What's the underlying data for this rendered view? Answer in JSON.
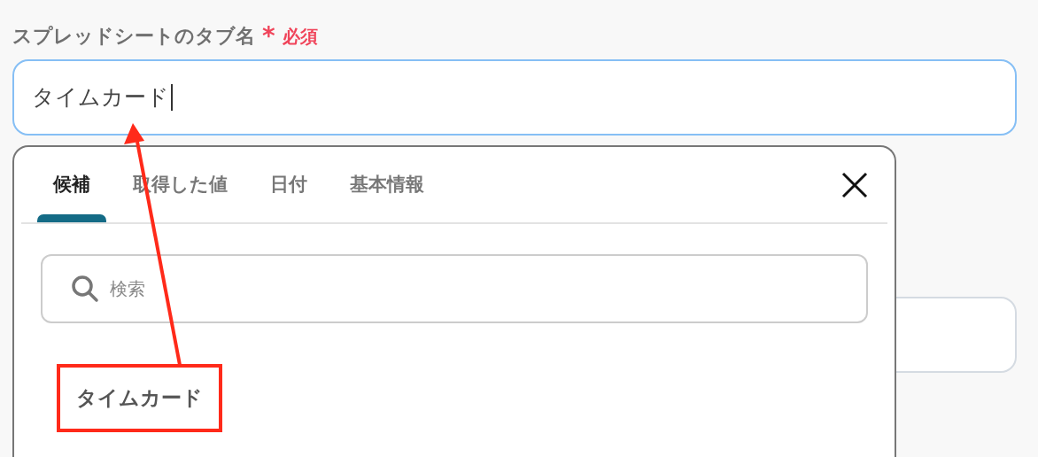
{
  "field": {
    "label": "スプレッドシートのタブ名",
    "required_mark": "*",
    "required": "必須",
    "value": "タイムカード"
  },
  "dropdown": {
    "tabs": [
      {
        "label": "候補",
        "selected": true
      },
      {
        "label": "取得した値",
        "selected": false
      },
      {
        "label": "日付",
        "selected": false
      },
      {
        "label": "基本情報",
        "selected": false
      }
    ],
    "search": {
      "placeholder": "検索"
    },
    "suggestions": [
      {
        "label": "タイムカード",
        "highlighted": true
      }
    ]
  }
}
